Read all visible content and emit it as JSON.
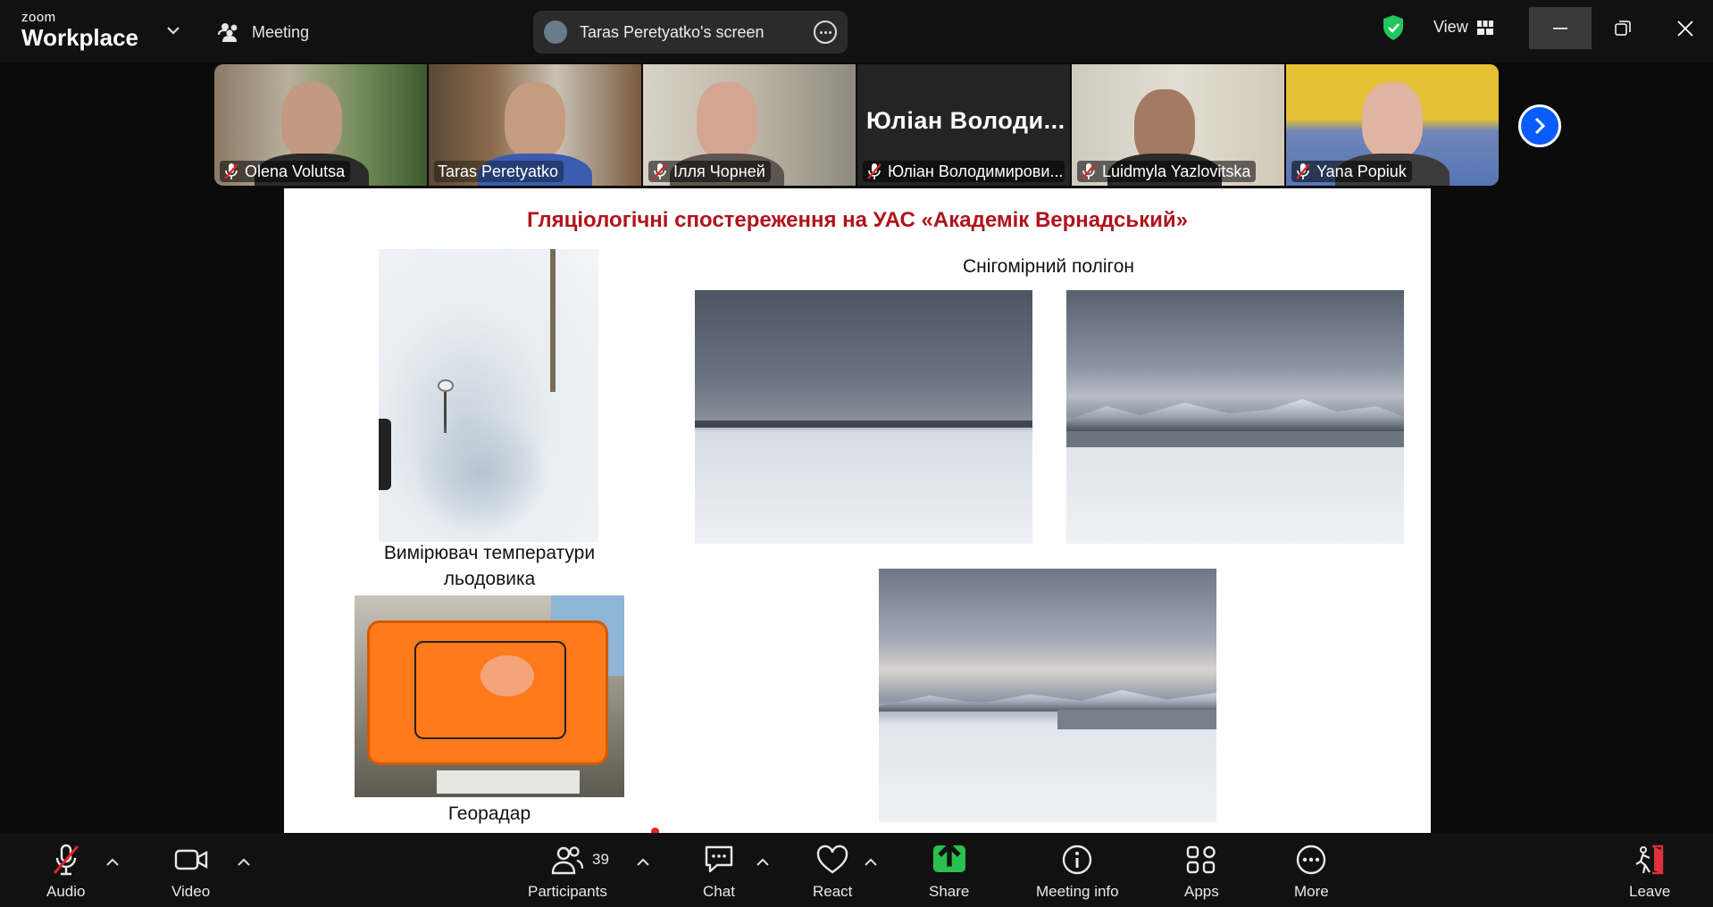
{
  "app": {
    "logo_small": "zoom",
    "logo_big": "Workplace",
    "meeting_label": "Meeting",
    "screen_share_label": "Taras Peretyatko's screen",
    "view_label": "View"
  },
  "participants": [
    {
      "name": "Olena Volutsa",
      "muted": true
    },
    {
      "name": "Taras Peretyatko",
      "muted": false,
      "active_speaker": true
    },
    {
      "name": "Ілля Чорней",
      "muted": true
    },
    {
      "name": "Юліан Володимирови...",
      "muted": true,
      "no_video": true,
      "display_name": "Юліан  Володи..."
    },
    {
      "name": "Luidmyla Yazlovitska",
      "muted": true
    },
    {
      "name": "Yana Popiuk",
      "muted": true
    }
  ],
  "slide": {
    "title": "Гляціологічні спостереження на УАС «Академік Вернадський»",
    "snow_polygon_caption": "Снігомірний полігон",
    "glacier_temp_caption_line1": "Вимірювач температури",
    "glacier_temp_caption_line2": "льодовика",
    "georadar_caption": "Георадар"
  },
  "toolbar": {
    "audio": "Audio",
    "video": "Video",
    "participants": "Participants",
    "participants_count": "39",
    "chat": "Chat",
    "react": "React",
    "share": "Share",
    "meeting_info": "Meeting info",
    "apps": "Apps",
    "more": "More",
    "leave": "Leave"
  },
  "colors": {
    "slide_title": "#b0141c",
    "active_speaker_border": "#2ecc71",
    "share_button": "#2bbf4e",
    "next_button": "#0b5cff",
    "leave_icon": "#e0303a"
  }
}
